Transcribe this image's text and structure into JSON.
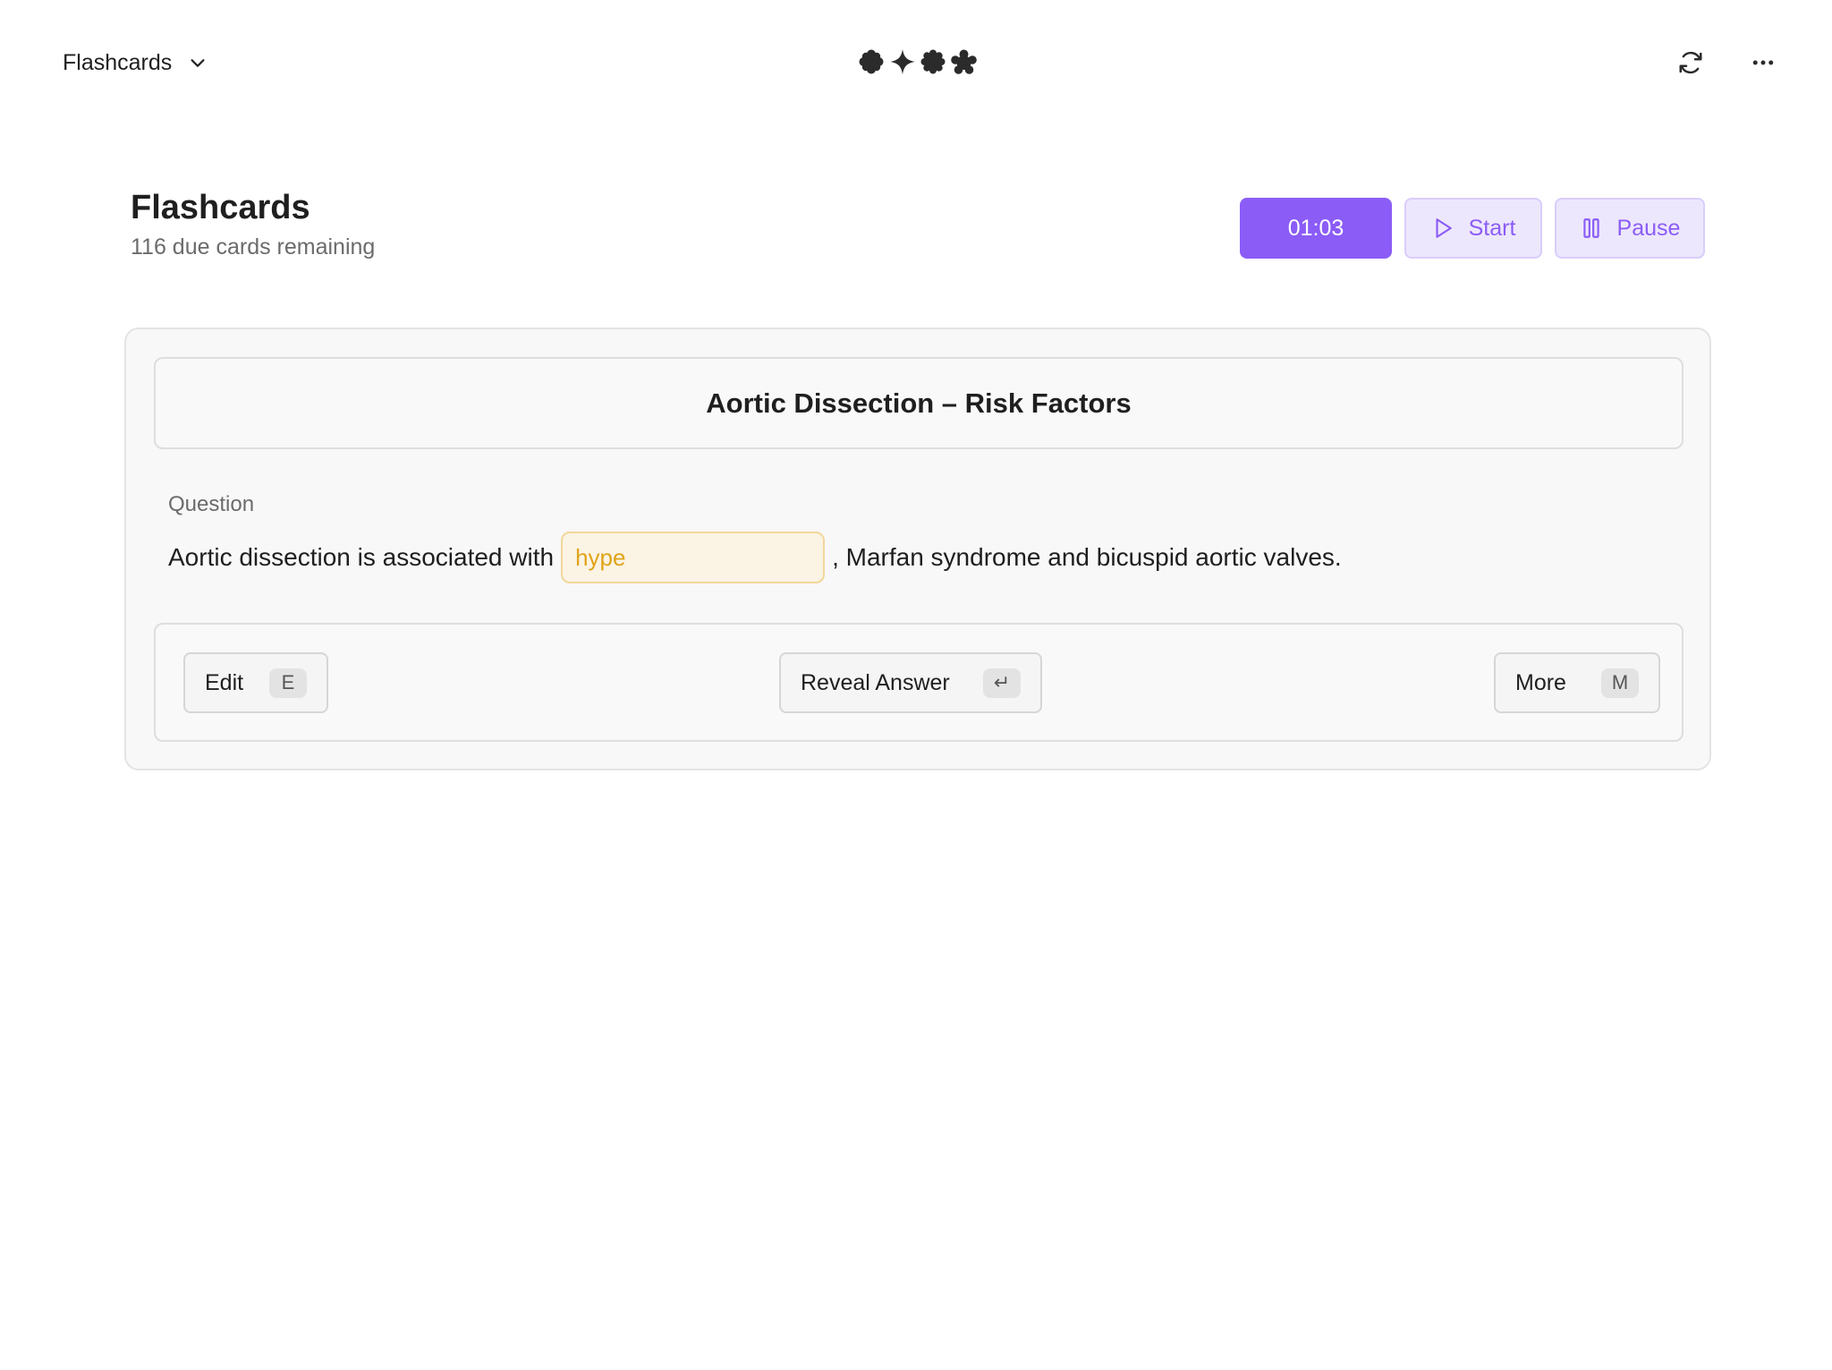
{
  "topbar": {
    "deck_switcher_label": "Flashcards",
    "deck_switcher_icon": "chevron-down-icon",
    "logo_icons": [
      "asterisk-blob-icon",
      "sparkle-icon",
      "octagon-blob-icon",
      "star-blob-icon"
    ],
    "sync_icon": "refresh-icon",
    "menu_icon": "more-horizontal-icon"
  },
  "header": {
    "title": "Flashcards",
    "subtitle": "116 due cards remaining"
  },
  "controls": {
    "timer": "01:03",
    "start_label": "Start",
    "start_icon": "play-icon",
    "pause_label": "Pause",
    "pause_icon": "pause-icon"
  },
  "card": {
    "title": "Aortic Dissection – Risk Factors",
    "question_label": "Question",
    "question_before": "Aortic dissection is associated with",
    "cloze_value": "hype",
    "question_after": ", Marfan syndrome and bicuspid aortic valves."
  },
  "actions": {
    "edit_label": "Edit",
    "edit_key": "E",
    "reveal_label": "Reveal Answer",
    "reveal_key": "↵",
    "more_label": "More",
    "more_key": "M"
  },
  "colors": {
    "accent": "#8b5cf6",
    "accent_soft": "#ede7fd",
    "cloze_bg": "#fbf3e4",
    "cloze_text": "#e0a419"
  }
}
